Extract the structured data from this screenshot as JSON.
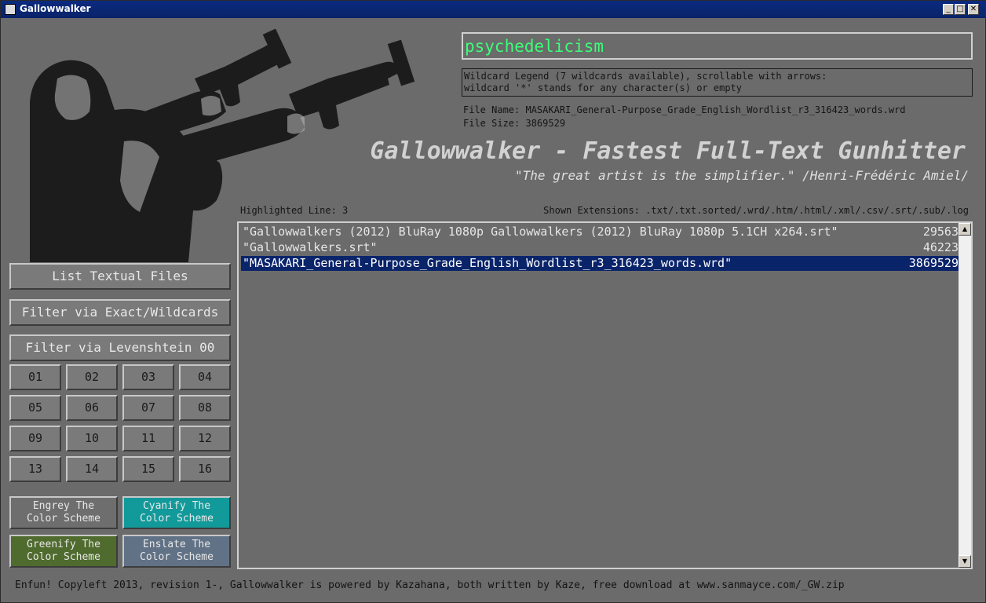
{
  "window": {
    "title": "Gallowwalker",
    "min_glyph": "_",
    "max_glyph": "□",
    "close_glyph": "✕"
  },
  "search": {
    "value": "psychedelicism"
  },
  "legend": {
    "line1": "Wildcard Legend (7 wildcards available), scrollable with arrows:",
    "line2": "wildcard '*' stands for any character(s) or empty"
  },
  "file": {
    "name_line": "File Name: MASAKARI_General-Purpose_Grade_English_Wordlist_r3_316423_words.wrd",
    "size_line": "File Size: 3869529"
  },
  "header": {
    "title": "Gallowwalker - Fastest Full-Text Gunhitter",
    "quote": "\"The great artist is the simplifier.\" /Henri-Frédéric Amiel/"
  },
  "status": {
    "highlighted": "Highlighted Line: 3",
    "extensions": "Shown Extensions: .txt/.txt.sorted/.wrd/.htm/.html/.xml/.csv/.srt/.sub/.log"
  },
  "files": [
    {
      "name": "\"Gallowwalkers (2012) BluRay 1080p Gallowwalkers (2012) BluRay 1080p 5.1CH x264.srt\"",
      "size": "29563"
    },
    {
      "name": "\"Gallowwalkers.srt\"",
      "size": "46223"
    },
    {
      "name": "\"MASAKARI_General-Purpose_Grade_English_Wordlist_r3_316423_words.wrd\"",
      "size": "3869529"
    }
  ],
  "scroll": {
    "up": "▲",
    "down": "▼"
  },
  "buttons": {
    "list": "List Textual Files",
    "exact": "Filter via Exact/Wildcards",
    "lev": "Filter via Levenshtein 00"
  },
  "levels": [
    "01",
    "02",
    "03",
    "04",
    "05",
    "06",
    "07",
    "08",
    "09",
    "10",
    "11",
    "12",
    "13",
    "14",
    "15",
    "16"
  ],
  "schemes": [
    {
      "l1": "Engrey The",
      "l2": "Color Scheme",
      "color": "#6e6e6e"
    },
    {
      "l1": "Cyanify The",
      "l2": "Color Scheme",
      "color": "#129a9a"
    },
    {
      "l1": "Greenify The",
      "l2": "Color Scheme",
      "color": "#4f6b2e"
    },
    {
      "l1": "Enslate The",
      "l2": "Color Scheme",
      "color": "#617286"
    }
  ],
  "footer": "Enfun! Copyleft 2013, revision 1-, Gallowwalker is powered by Kazahana, both written by Kaze, free download at www.sanmayce.com/_GW.zip"
}
